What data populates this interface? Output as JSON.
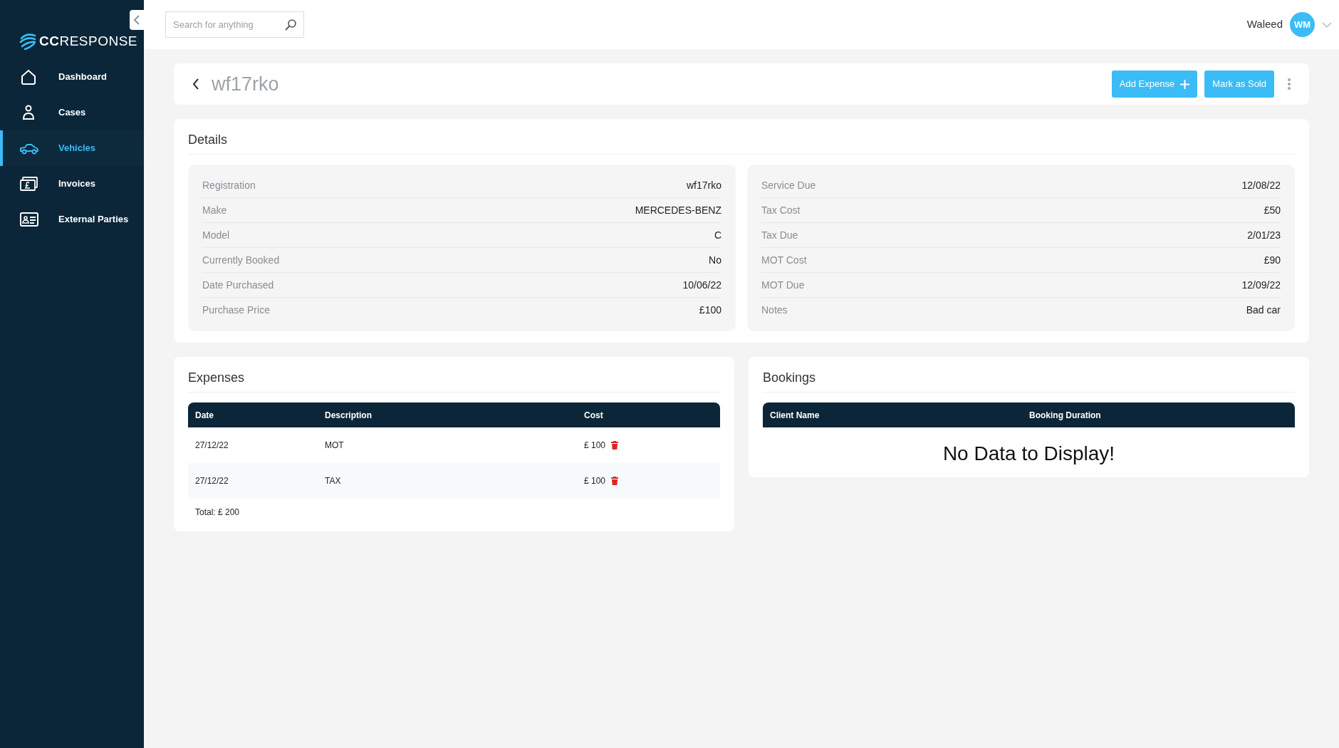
{
  "sidebar": {
    "logo": {
      "prefix": "CC",
      "suffix": "RESPONSE"
    },
    "items": [
      {
        "label": "Dashboard",
        "kind": "home",
        "selected": false
      },
      {
        "label": "Cases",
        "kind": "person",
        "selected": false
      },
      {
        "label": "Vehicles",
        "kind": "car",
        "selected": true
      },
      {
        "label": "Invoices",
        "kind": "money",
        "selected": false
      },
      {
        "label": "External Parties",
        "kind": "card",
        "selected": false
      }
    ]
  },
  "search": {
    "placeholder": "Search for anything"
  },
  "user": {
    "name": "Waleed",
    "initials": "WM"
  },
  "header": {
    "title": "wf17rko",
    "buttons": [
      {
        "label": "Add Expense",
        "plus": true
      },
      {
        "label": "Mark as Sold",
        "plus": false
      }
    ]
  },
  "details": {
    "title": "Details",
    "left": [
      {
        "label": "Registration",
        "value": "wf17rko"
      },
      {
        "label": "Make",
        "value": "MERCEDES-BENZ"
      },
      {
        "label": "Model",
        "value": "C"
      },
      {
        "label": "Currently Booked",
        "value": "No"
      },
      {
        "label": "Date Purchased",
        "value": "10/06/22"
      },
      {
        "label": "Purchase Price",
        "value": "£100"
      }
    ],
    "right": [
      {
        "label": "Service Due",
        "value": "12/08/22"
      },
      {
        "label": "Tax Cost",
        "value": "£50"
      },
      {
        "label": "Tax Due",
        "value": "2/01/23"
      },
      {
        "label": "MOT Cost",
        "value": "£90"
      },
      {
        "label": "MOT Due",
        "value": "12/09/22"
      },
      {
        "label": "Notes",
        "value": "Bad car"
      }
    ]
  },
  "expenses": {
    "title": "Expenses",
    "columns": [
      "Date",
      "Description",
      "Cost"
    ],
    "rows": [
      {
        "date": "27/12/22",
        "description": "MOT",
        "cost": "£ 100"
      },
      {
        "date": "27/12/22",
        "description": "TAX",
        "cost": "£ 100"
      }
    ],
    "total": "Total: £ 200"
  },
  "bookings": {
    "title": "Bookings",
    "columns": [
      "Client Name",
      "Booking Duration"
    ],
    "empty": "No Data to Display!"
  }
}
